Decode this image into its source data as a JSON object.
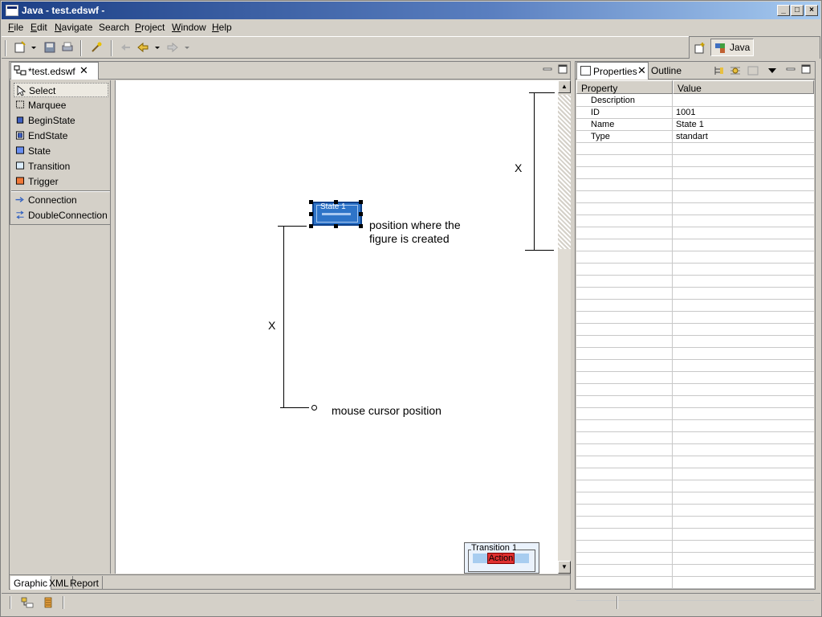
{
  "window": {
    "title": "Java - test.edswf -"
  },
  "menu": {
    "items": [
      {
        "label": "File",
        "ul": "F",
        "rest": "ile"
      },
      {
        "label": "Edit",
        "ul": "E",
        "rest": "dit"
      },
      {
        "label": "Navigate",
        "ul": "N",
        "rest": "avigate"
      },
      {
        "label": "Search",
        "ul": "S",
        "rest": "earch",
        "pre": ""
      },
      {
        "label": "Project",
        "ul": "P",
        "rest": "roject"
      },
      {
        "label": "Window",
        "ul": "W",
        "rest": "indow"
      },
      {
        "label": "Help",
        "ul": "H",
        "rest": "elp"
      }
    ]
  },
  "perspective": {
    "label": "Java"
  },
  "editor": {
    "tab_label": "*test.edswf",
    "palette": [
      {
        "label": "Select",
        "icon": "arrow-pointer-icon"
      },
      {
        "label": "Marquee",
        "icon": "marquee-icon"
      },
      {
        "label": "BeginState",
        "icon": "begin-state-icon"
      },
      {
        "label": "EndState",
        "icon": "end-state-icon"
      },
      {
        "label": "State",
        "icon": "state-icon"
      },
      {
        "label": "Transition",
        "icon": "transition-icon"
      },
      {
        "label": "Trigger",
        "icon": "trigger-icon"
      },
      {
        "label": "Connection",
        "icon": "connection-icon"
      },
      {
        "label": "DoubleConnection",
        "icon": "double-connection-icon"
      }
    ],
    "canvas": {
      "state_label": "State 1",
      "note_created": "position where the\nfigure is created",
      "note_created_line1": "position where the",
      "note_created_line2": "figure is created",
      "note_cursor": "mouse cursor position",
      "dim_label_left": "X",
      "dim_label_right": "X",
      "transition_label": "Transition 1",
      "action_label": "Action"
    },
    "bottom_tabs": [
      {
        "label": "Graphic"
      },
      {
        "label": "XML"
      },
      {
        "label": "Report"
      }
    ]
  },
  "properties": {
    "tab_label": "Properties",
    "tab2_label": "Outline",
    "headers": {
      "property": "Property",
      "value": "Value"
    },
    "rows": [
      {
        "key": "Description",
        "value": ""
      },
      {
        "key": "ID",
        "value": "1001"
      },
      {
        "key": "Name",
        "value": "State 1"
      },
      {
        "key": "Type",
        "value": "standart"
      }
    ]
  }
}
